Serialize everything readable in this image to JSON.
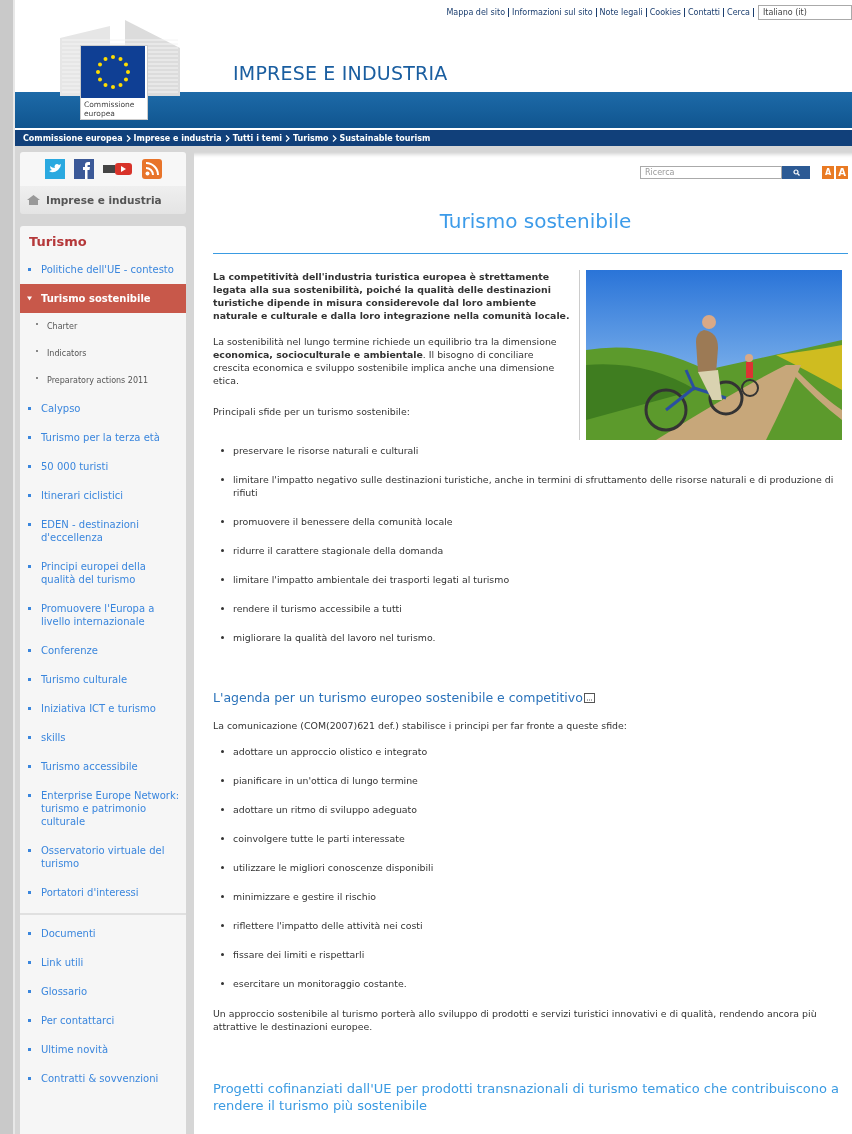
{
  "top_links": [
    "Mappa del sito",
    "Informazioni sul sito",
    "Note legali",
    "Cookies",
    "Contatti",
    "Cerca"
  ],
  "language_select": {
    "value": "Italiano (it)"
  },
  "header": {
    "logo_text": "Commissione europea",
    "title": "IMPRESE E INDUSTRIA"
  },
  "breadcrumb": [
    "Commissione europea",
    "Imprese e industria",
    "Tutti i temi",
    "Turismo",
    "Sustainable tourism"
  ],
  "sidebar": {
    "home_link": "Imprese e industria",
    "section_title": "Turismo",
    "items": [
      {
        "label": "Politiche dell'UE - contesto",
        "selected": false
      },
      {
        "label": "Turismo sostenibile",
        "selected": true,
        "children": [
          {
            "label": "Charter"
          },
          {
            "label": "Indicators"
          },
          {
            "label": "Preparatory actions 2011"
          }
        ]
      },
      {
        "label": "Calypso",
        "selected": false
      },
      {
        "label": "Turismo per la terza età",
        "selected": false
      },
      {
        "label": "50 000 turisti",
        "selected": false
      },
      {
        "label": "Itinerari ciclistici",
        "selected": false
      },
      {
        "label": "EDEN - destinazioni d'eccellenza",
        "selected": false
      },
      {
        "label": "Principi europei della qualità del turismo",
        "selected": false
      },
      {
        "label": "Promuovere l'Europa a livello internazionale",
        "selected": false
      },
      {
        "label": "Conferenze",
        "selected": false
      },
      {
        "label": "Turismo culturale",
        "selected": false
      },
      {
        "label": "Iniziativa ICT e turismo",
        "selected": false
      },
      {
        "label": "skills",
        "selected": false
      },
      {
        "label": "Turismo accessibile",
        "selected": false
      },
      {
        "label": "Enterprise Europe Network: turismo e patrimonio culturale",
        "selected": false
      },
      {
        "label": "Osservatorio virtuale del turismo",
        "selected": false
      },
      {
        "label": "Portatori d'interessi",
        "selected": false
      }
    ],
    "footer_items": [
      {
        "label": "Documenti",
        "selected": false
      },
      {
        "label": "Link utili",
        "selected": false
      },
      {
        "label": "Glossario",
        "selected": false
      },
      {
        "label": "Per contattarci",
        "selected": false
      },
      {
        "label": "Ultime novità",
        "selected": false
      },
      {
        "label": "Contratti & sovvenzioni",
        "selected": false
      }
    ]
  },
  "search": {
    "placeholder": "Ricerca"
  },
  "font_size_buttons": [
    "A",
    "A"
  ],
  "main": {
    "title": "Turismo sostenibile",
    "intro": "La competitività dell'industria turistica europea è strettamente legata alla sua sostenibilità, poiché la qualità delle destinazioni turistiche dipende in misura considerevole dal loro ambiente naturale e culturale e dalla loro integrazione nella comunità locale.",
    "paragraph": "La sostenibilità nel lungo termine richiede un equilibrio tra la dimensione **economica, socioculturale e ambientale**. Il bisogno di conciliare crescita economica e sviluppo sostenibile implica anche una dimensione etica.",
    "challenges_intro": "Principali sfide per un turismo sostenibile:",
    "challenges": [
      "preservare le risorse naturali e culturali",
      "limitare l'impatto negativo sulle destinazioni turistiche, anche in termini di sfruttamento delle risorse naturali e di produzione di rifiuti",
      "promuovere il benessere della comunità locale",
      "ridurre il carattere stagionale della domanda",
      "limitare l'impatto ambientale dei trasporti legati al turismo",
      "rendere il turismo accessibile a tutti",
      "migliorare la qualità del lavoro nel turismo."
    ],
    "agenda_heading": "L'agenda per un turismo europeo sostenibile e competitivo",
    "agenda_intro": "La comunicazione (COM(2007)621 def.) stabilisce i principi per far fronte a queste sfide:",
    "principles": [
      "adottare un approccio olistico e integrato",
      "pianificare in un'ottica di lungo termine",
      "adottare un ritmo di sviluppo adeguato",
      "coinvolgere tutte le parti interessate",
      "utilizzare le migliori conoscenze disponibili",
      "minimizzare e gestire il rischio",
      "riflettere l'impatto delle attività nei costi",
      "fissare dei limiti e rispettarli",
      "esercitare un monitoraggio costante."
    ],
    "closing": "Un approccio sostenibile al turismo porterà allo sviluppo di prodotti e servizi turistici innovativi e di qualità, rendendo ancora più attrattive le destinazioni europee.",
    "projects_heading": "Progetti cofinanziati dall'UE per prodotti transnazionali di turismo tematico che contribuiscono a rendere il turismo più sostenibile"
  }
}
